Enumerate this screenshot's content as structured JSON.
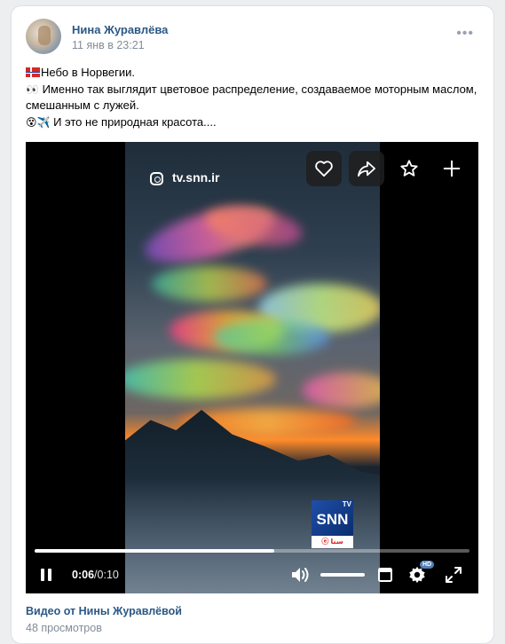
{
  "post": {
    "author": "Нина Журавлёва",
    "date": "11 янв в 23:21",
    "more": "•••",
    "line1": "Небо в Норвегии.",
    "line2_emoji": "👀",
    "line2": " Именно так выглядит цветовое распределение, создаваемое моторным маслом, смешанным с лужей.",
    "line3_emoji": "😵✈️",
    "line3": " И это не природная красота...."
  },
  "video": {
    "watermark": "tv.snn.ir",
    "logo_text": "SNN",
    "logo_tv": "TV",
    "logo_sub": "ⓔ ﺳﻨﺎ",
    "current_time": "0:06",
    "separator": " / ",
    "duration": "0:10",
    "progress": 0.55,
    "hd_badge": "HD",
    "icons": {
      "like": "heart-icon",
      "share": "share-icon",
      "favorite": "star-icon",
      "add": "plus-icon",
      "pause": "pause-icon",
      "volume": "volume-icon",
      "fullscreen": "fullscreen-icon",
      "settings": "gear-icon",
      "window": "picture-in-picture-icon"
    }
  },
  "footer": {
    "caption": "Видео от Нины Журавлёвой",
    "views": "48 просмотров"
  },
  "colors": {
    "link": "#2a5885",
    "muted": "#818c99",
    "page_bg": "#edeef0"
  }
}
